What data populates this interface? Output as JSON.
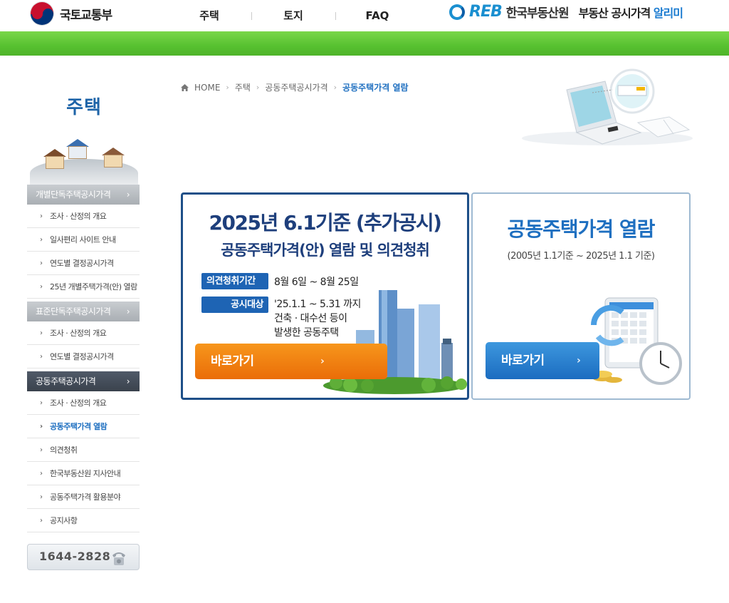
{
  "header": {
    "gov_name": "국토교통부",
    "nav": [
      "주택",
      "토지",
      "FAQ"
    ],
    "reb_letters": "REB",
    "reb_name": "한국부동산원",
    "service_name": "부동산 공시가격",
    "service_accent": "알리미"
  },
  "sidebar": {
    "title": "주택",
    "groups": [
      {
        "label": "개별단독주택공시가격",
        "chevron": "›",
        "active": false,
        "items": [
          "조사 · 산정의 개요",
          "일사편리 사이트 안내",
          "연도별 결정공시가격",
          "25년 개별주택가격(안) 열람"
        ]
      },
      {
        "label": "표준단독주택공시가격",
        "chevron": "›",
        "active": false,
        "items": [
          "조사 · 산정의 개요",
          "연도별 결정공시가격"
        ]
      },
      {
        "label": "공동주택공시가격",
        "chevron": "›",
        "active": true,
        "items": [
          "조사 · 산정의 개요",
          "공동주택가격 열람",
          "의견청취",
          "한국부동산원 지사안내",
          "공동주택가격 활용분야",
          "공지사항"
        ]
      }
    ],
    "current_item": "공동주택가격 열람",
    "bullet": "›",
    "phone": "1644-2828"
  },
  "breadcrumb": {
    "home": "HOME",
    "sep": "›",
    "items": [
      "주택",
      "공동주택공시가격",
      "공동주택가격 열람"
    ]
  },
  "banner_left": {
    "title1": "2025년 6.1기준 (추가공시)",
    "title2": "공동주택가격(안) 열람 및 의견청취",
    "tag1_label": "의견청취기간",
    "tag1_value": "8월 6일 ~ 8월 25일",
    "tag2_label": "공시대상",
    "tag2_line1": "'25.1.1 ~ 5.31 까지",
    "tag2_line2": "건축 · 대수선 등이",
    "tag2_line3": "발생한 공동주택",
    "button_label": "바로가기",
    "button_arrow": "›"
  },
  "banner_right": {
    "title": "공동주택가격 열람",
    "subtitle": "(2005년 1.1기준 ~ 2025년 1.1 기준)",
    "button_label": "바로가기",
    "button_arrow": "›"
  },
  "colors": {
    "green_band": "#57c130",
    "nav_blue": "#1e3f7c",
    "accent_blue": "#1e6fc0",
    "orange": "#ea6d08"
  }
}
